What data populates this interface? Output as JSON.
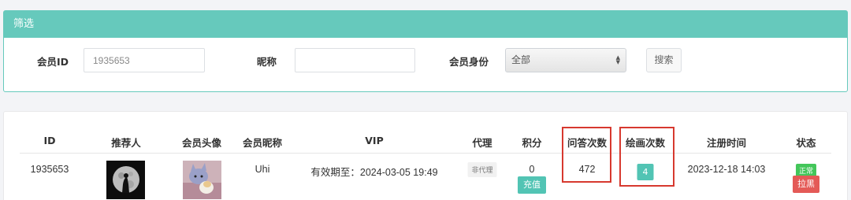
{
  "filter": {
    "title": "筛选",
    "member_id_label": "会员ID",
    "member_id_value": "1935653",
    "nickname_label": "昵称",
    "nickname_value": "",
    "identity_label": "会员身份",
    "identity_selected": "全部",
    "search_label": "搜索"
  },
  "table": {
    "columns": [
      "ID",
      "推荐人",
      "会员头像",
      "会员昵称",
      "VIP",
      "代理",
      "积分",
      "问答次数",
      "绘画次数",
      "注册时间",
      "状态"
    ],
    "row": {
      "id": "1935653",
      "nickname": "Uhi",
      "vip": "有效期至：2024-03-05 19:49",
      "agent": "非代理",
      "points": "0",
      "recharge_label": "充值",
      "qa_count": "472",
      "draw_count": "4",
      "register_time": "2023-12-18 14:03",
      "status": "正常",
      "block_label": "拉黑"
    }
  },
  "colors": {
    "accent": "#66c9bc",
    "button_teal": "#52c4b4",
    "highlight_red": "#d7392f",
    "status_green": "#43c65a",
    "block_red": "#e45a57"
  },
  "icons": {
    "select_arrows": "updown-chevron-icon"
  }
}
